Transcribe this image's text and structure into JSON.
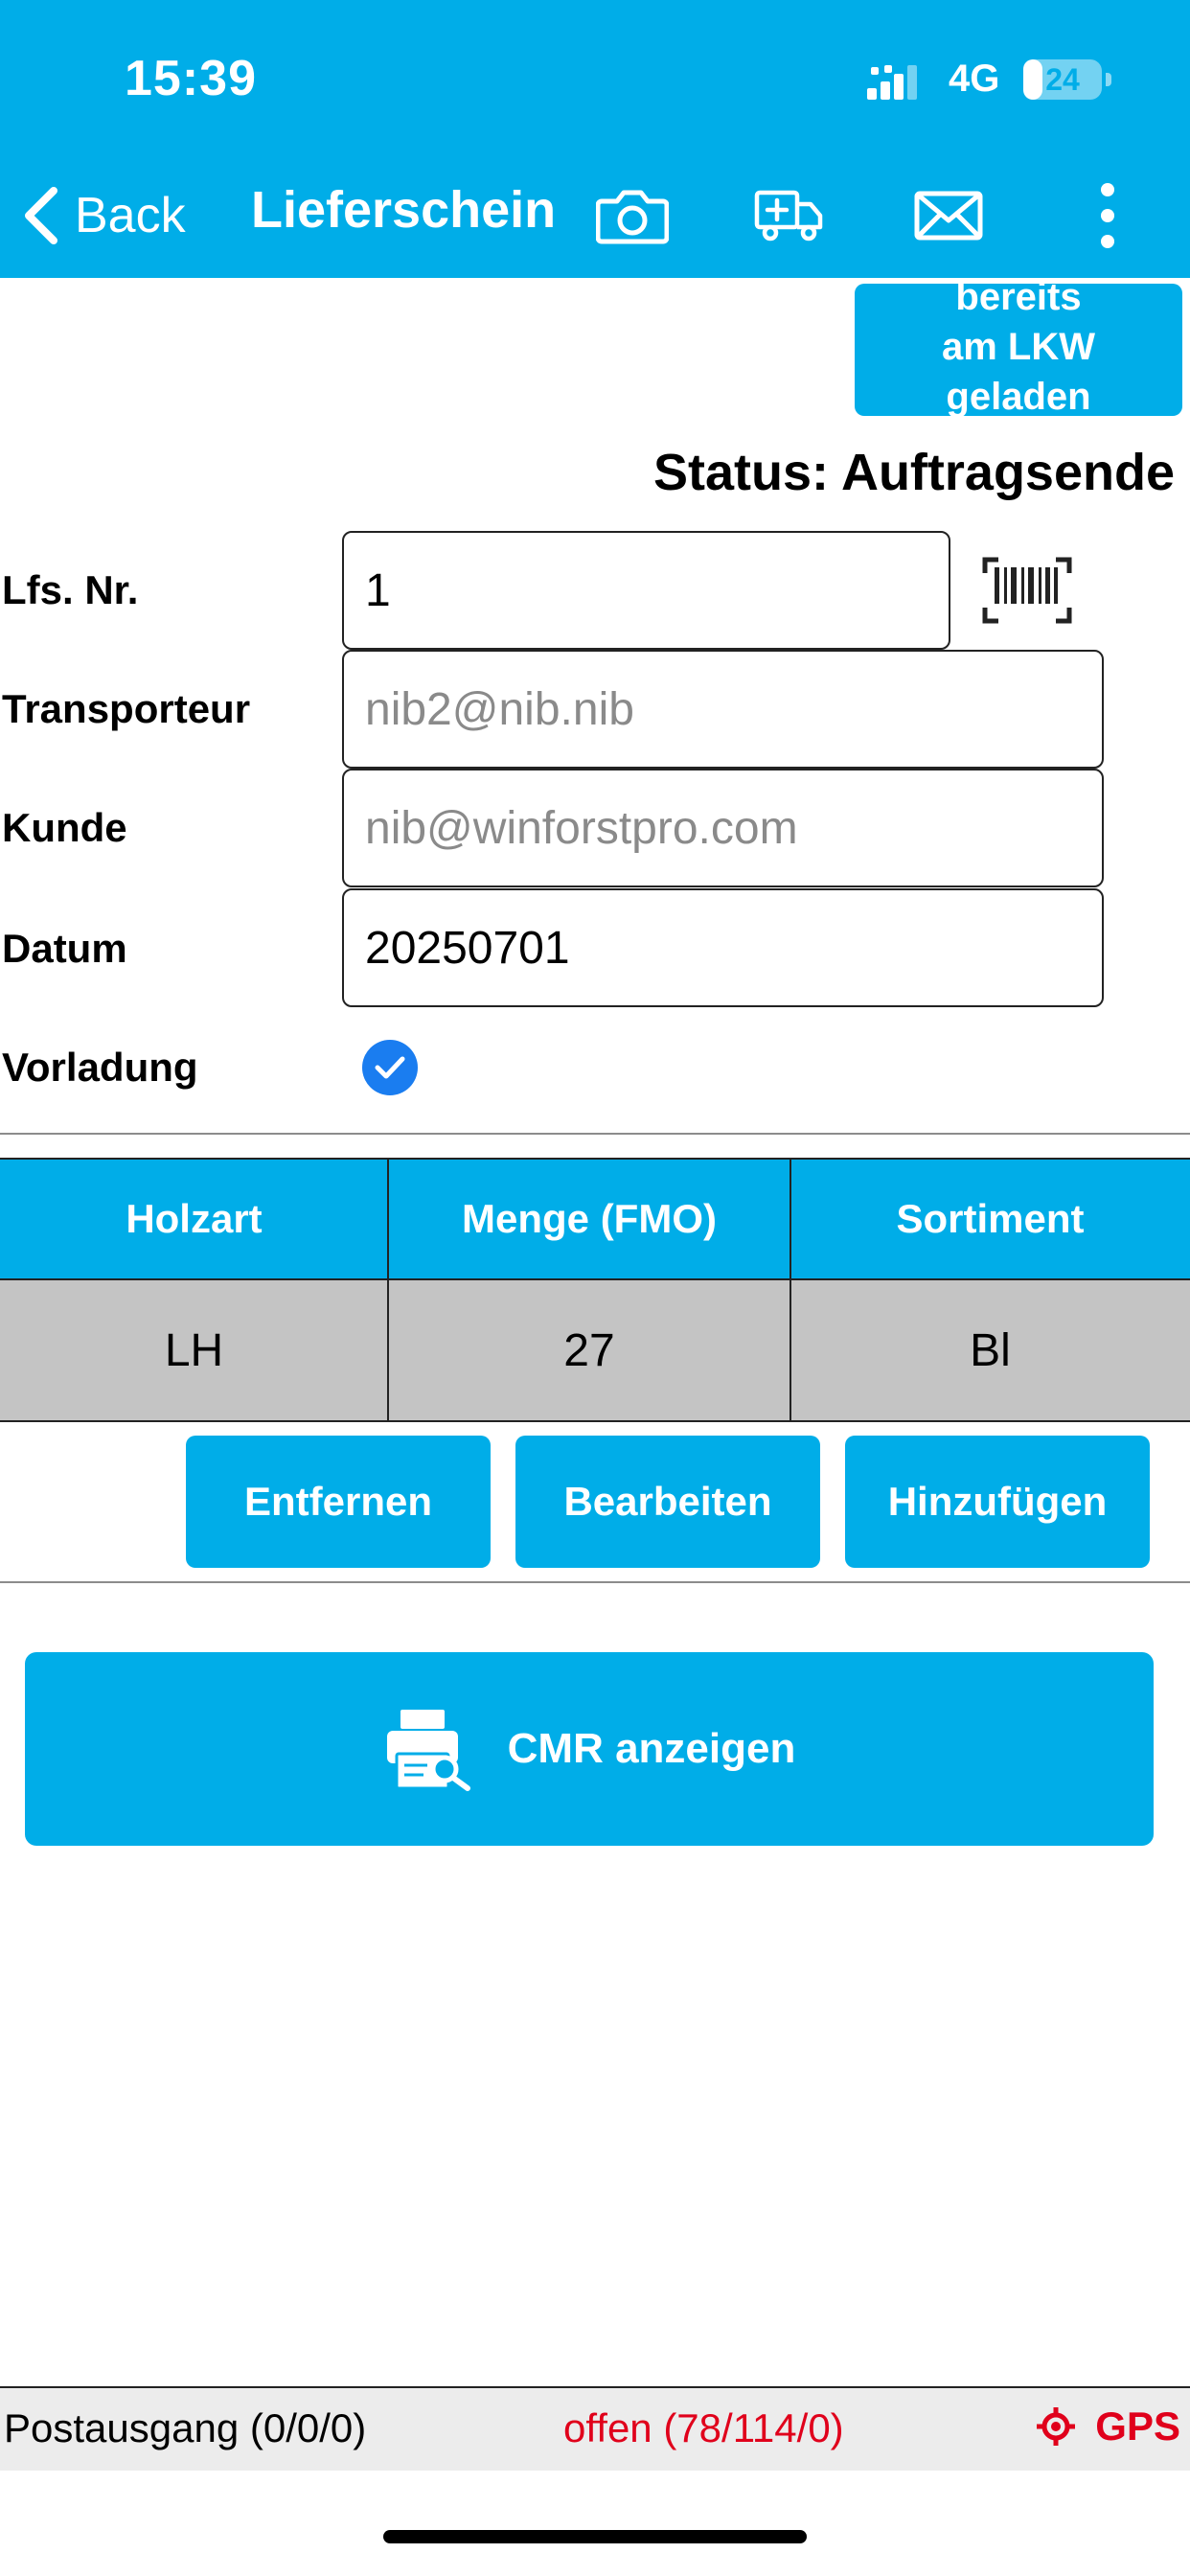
{
  "statusbar": {
    "time": "15:39",
    "network": "4G",
    "battery_level": "24",
    "battery_fraction": 0.24
  },
  "navbar": {
    "back_label": "Back",
    "title": "Lieferschein",
    "icons": [
      "camera-icon",
      "truck-add-icon",
      "mail-icon",
      "more-vertical-icon"
    ]
  },
  "loaded_button": {
    "lines": [
      "bereits",
      "am LKW",
      "geladen"
    ]
  },
  "status": {
    "text": "Status: Auftragsende"
  },
  "form": {
    "lfs_nr": {
      "label": "Lfs. Nr.",
      "value": "1"
    },
    "transporteur": {
      "label": "Transporteur",
      "placeholder": "nib2@nib.nib"
    },
    "kunde": {
      "label": "Kunde",
      "placeholder": "nib@winforstpro.com"
    },
    "datum": {
      "label": "Datum",
      "value": "20250701"
    },
    "vorladung": {
      "label": "Vorladung",
      "checked": true
    }
  },
  "table": {
    "headers": [
      "Holzart",
      "Menge (FMO)",
      "Sortiment"
    ],
    "rows": [
      [
        "LH",
        "27",
        "Bl"
      ]
    ]
  },
  "actions": {
    "remove": "Entfernen",
    "edit": "Bearbeiten",
    "add": "Hinzufügen"
  },
  "cmr_button": {
    "label": "CMR anzeigen"
  },
  "footer": {
    "outbox": "Postausgang (0/0/0)",
    "open": "offen (78/114/0)",
    "gps": "GPS"
  },
  "colors": {
    "accent": "#00ade8",
    "row_bg": "#c4c4c4",
    "alert": "#e0001b",
    "check": "#1a7df0"
  }
}
